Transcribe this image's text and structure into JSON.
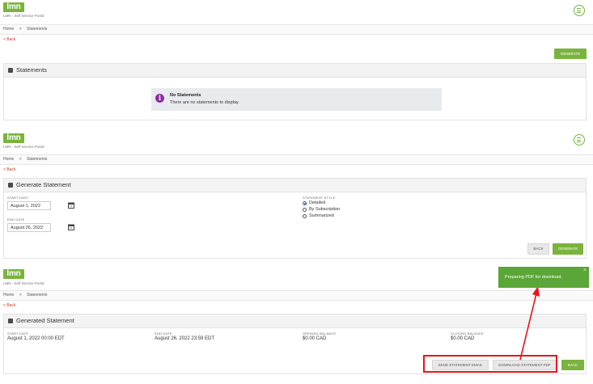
{
  "brand": {
    "logo_text": "lmn",
    "portal_name": "LMN - Self Service Portal",
    "accent": "#7ab33e"
  },
  "breadcrumb": {
    "home": "Home",
    "separator": ">",
    "current": "Statements"
  },
  "back_link": "< Back",
  "panel1": {
    "title": "Statements",
    "generate_button": "GENERATE",
    "empty_title": "No Statements",
    "empty_text": "There are no statements to display."
  },
  "panel2": {
    "title": "Generate Statement",
    "start_label": "START DATE",
    "start_value": "August 1, 2022",
    "end_label": "END DATE",
    "end_value": "August 26, 2022",
    "style_label": "STATEMENT STYLE",
    "styles": [
      "Detailed",
      "By Subscription",
      "Summarized"
    ],
    "selected_style": "Detailed",
    "back_button": "BACK",
    "generate_button": "GENERATE"
  },
  "panel3": {
    "title": "Generated Statement",
    "start_label": "START DATE",
    "start_value": "August 1, 2022 00:00 EDT",
    "end_label": "END DATE",
    "end_value": "August 26, 2022 23:59 EDT",
    "opening_label": "OPENING BALANCE",
    "opening_value": "$0.00 CAD",
    "closing_label": "CLOSING BALANCE",
    "closing_value": "$0.00 CAD",
    "send_email_button": "SEND STATEMENT EMAIL",
    "download_pdf_button": "DOWNLOAD STATEMENT PDF",
    "back_button": "BACK"
  },
  "toast": {
    "message": "Preparing PDF for download.",
    "close": "×"
  },
  "icons": {
    "menu": "menu-icon",
    "info": "info-icon",
    "calendar": "calendar-icon",
    "document": "document-icon"
  }
}
